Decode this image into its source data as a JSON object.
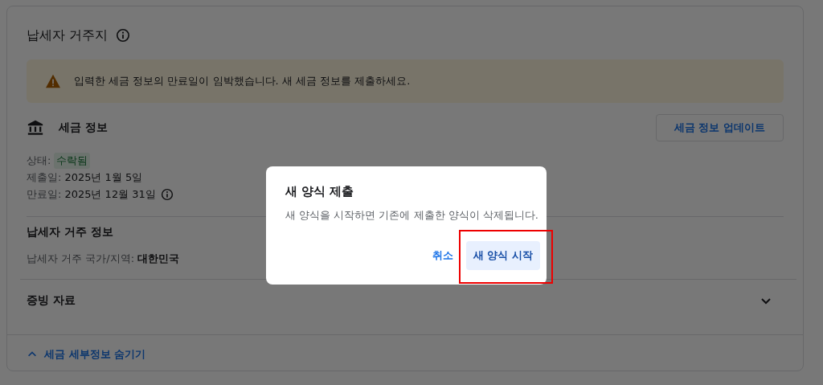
{
  "section": {
    "title": "납세자 거주지",
    "alert": "입력한 세금 정보의 만료일이 임박했습니다. 새 세금 정보를 제출하세요.",
    "tax_info": {
      "title": "세금 정보",
      "update_button": "세금 정보 업데이트",
      "status_label": "상태:",
      "status_value": "수락됨",
      "submitted_label": "제출일:",
      "submitted_value": "2025년 1월 5일",
      "expiry_label": "만료일:",
      "expiry_value": "2025년 12월 31일"
    },
    "residence": {
      "title": "납세자 거주 정보",
      "country_label": "납세자 거주 국가/지역:",
      "country_value": "대한민국"
    },
    "documents": {
      "title": "증빙 자료",
      "expanded": false
    },
    "footer_link": "세금 세부정보 숨기기"
  },
  "dialog": {
    "title": "새 양식 제출",
    "message": "새 양식을 시작하면 기존에 제출한 양식이 삭제됩니다.",
    "buttons": [
      {
        "label": "취소",
        "kind": "text",
        "highlighted": false
      },
      {
        "label": "새 양식 시작",
        "kind": "tonal",
        "highlighted": true
      }
    ]
  }
}
